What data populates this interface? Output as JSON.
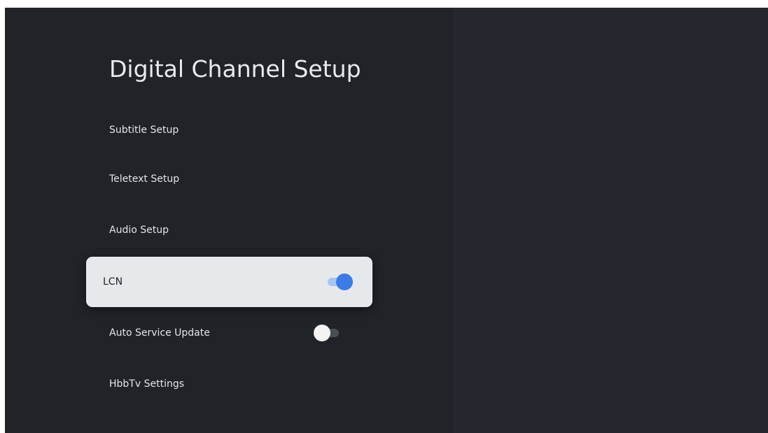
{
  "screen": {
    "title": "Digital Channel Setup"
  },
  "menu": {
    "items": [
      {
        "label": "Subtitle Setup"
      },
      {
        "label": "Teletext Setup"
      },
      {
        "label": "Audio Setup"
      },
      {
        "label": "LCN",
        "toggle": "on",
        "focused": true
      },
      {
        "label": "Auto Service Update",
        "toggle": "off"
      },
      {
        "label": "HbbTv Settings"
      }
    ]
  },
  "colors": {
    "background": "#202328",
    "right_panel": "#24272d",
    "focus_card": "#e6e9eb",
    "toggle_on": "#3c7be6",
    "toggle_off_thumb": "#f4f4f5"
  }
}
